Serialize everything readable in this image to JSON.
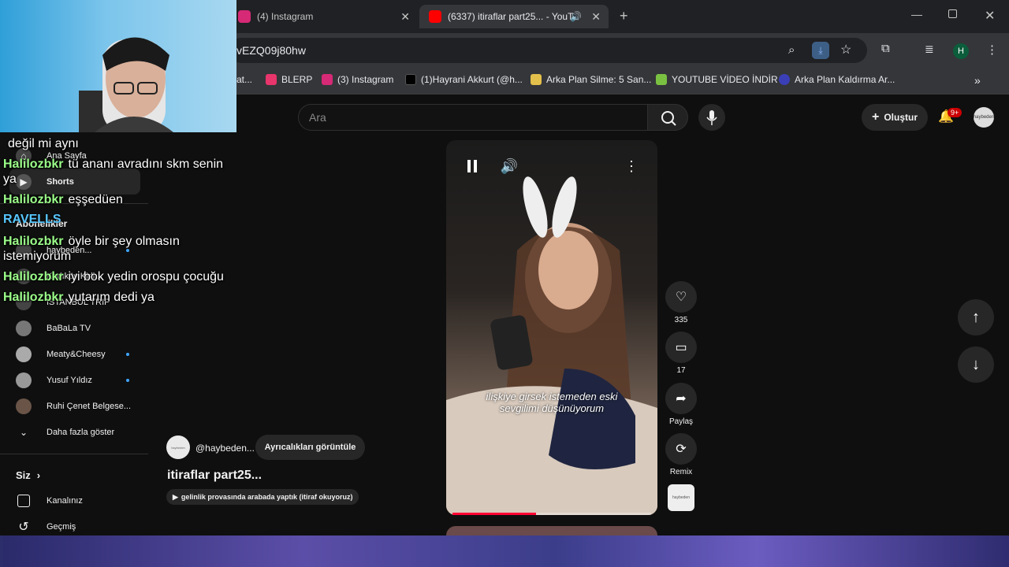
{
  "tabs": [
    {
      "title": "(4) Instagram",
      "favicon_color": "#d62976"
    },
    {
      "title": "(6337) itiraflar part25... - YouTu",
      "favicon_color": "#ff0000",
      "active": true
    }
  ],
  "url": "vEZQ09j80hw",
  "profile_initial": "H",
  "bookmarks": [
    {
      "label": "at...",
      "color": "#888"
    },
    {
      "label": "BLERP",
      "color": "#e8356b"
    },
    {
      "label": "(3) Instagram",
      "color": "#d62976"
    },
    {
      "label": "(1)Hayrani Akkurt (@h...",
      "color": "#111"
    },
    {
      "label": "Arka Plan Silme: 5 San...",
      "color": "#e3c04b"
    },
    {
      "label": "YOUTUBE VİDEO İNDİR",
      "color": "#7ac142"
    },
    {
      "label": "Arka Plan Kaldırma Ar...",
      "color": "#3b3fb7"
    }
  ],
  "header": {
    "search_placeholder": "Ara",
    "create_label": "Oluştur",
    "notifications_badge": "9+",
    "account_label": "haybeden"
  },
  "sidebar": {
    "items": [
      {
        "label": "Ana Sayfa",
        "icon": "home-icon"
      },
      {
        "label": "Shorts",
        "icon": "shorts-icon"
      }
    ],
    "subscriptions_label": "Abonelikler",
    "channels": [
      {
        "label": "haybeden...",
        "new": true
      },
      {
        "label": "Kadıköy Kirli...",
        "new": false
      },
      {
        "label": "İSTANBUL TRIP",
        "new": false
      },
      {
        "label": "BaBaLa TV",
        "new": false
      },
      {
        "label": "Meaty&Cheesy",
        "new": true
      },
      {
        "label": "Yusuf Yıldız",
        "new": true
      },
      {
        "label": "Ruhi Çenet Belgese...",
        "new": false
      }
    ],
    "show_more": "Daha fazla göster",
    "you_section": "Siz",
    "you_items": [
      {
        "label": "Kanalınız",
        "icon": "channel-icon"
      },
      {
        "label": "Geçmiş",
        "icon": "history-icon"
      }
    ]
  },
  "short": {
    "subtitle_line1": "ilişkiye girsek istemeden eski",
    "subtitle_line2": "sevgilimi düşünüyorum",
    "likes": "335",
    "comments": "17",
    "share_label": "Paylaş",
    "remix_label": "Remix",
    "progress": 0.42,
    "channel_handle": "@haybeden...",
    "join_label": "Ayrıcalıkları görüntüle",
    "title": "itiraflar part25...",
    "related_video": "gelinlik provasında arabada yaptık (itiraf okuyoruz)"
  },
  "chat": {
    "lines": [
      {
        "user": "",
        "text": "değil mi aynı"
      },
      {
        "user": "Halilozbkr",
        "text": "tü ananı avradını skm senin"
      },
      {
        "user": "",
        "text": "ya"
      },
      {
        "user": "Halilozbkr",
        "text": "eşşedüen"
      },
      {
        "user": "Halilozbkr",
        "text": "öyle bir şey olmasın"
      },
      {
        "user": "",
        "text": "istemiyorum"
      },
      {
        "user": "Halilozbkr",
        "text": "iyi bok yedin orospu çocuğu"
      },
      {
        "user": "Halilozbkr",
        "text": "yutarım dedi ya"
      }
    ],
    "event_name": "RAVELLS"
  }
}
